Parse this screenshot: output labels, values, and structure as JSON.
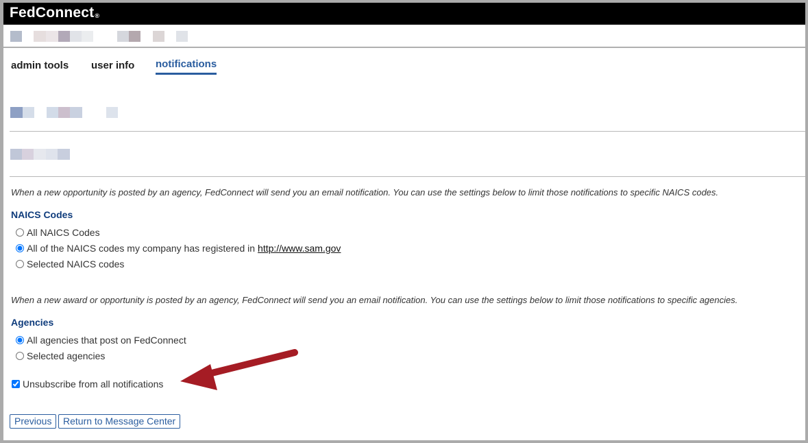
{
  "header": {
    "logo": "FedConnect",
    "registered_mark": "®"
  },
  "tabs": [
    {
      "label": "admin tools",
      "active": false
    },
    {
      "label": "user info",
      "active": false
    },
    {
      "label": "notifications",
      "active": true
    }
  ],
  "naics": {
    "intro": "When a new opportunity is posted by an agency, FedConnect will send you an email notification. You can use the settings below to limit those notifications to specific NAICS codes.",
    "title": "NAICS Codes",
    "options": [
      {
        "label": "All NAICS Codes",
        "selected": false
      },
      {
        "label": "All of the NAICS codes my company has registered in",
        "link": "http://www.sam.gov",
        "selected": true
      },
      {
        "label": "Selected NAICS codes",
        "selected": false
      }
    ]
  },
  "agencies": {
    "intro": "When a new award or opportunity is posted by an agency, FedConnect will send you an email notification. You can use the settings below to limit those notifications to specific agencies.",
    "title": "Agencies",
    "options": [
      {
        "label": "All agencies that post on FedConnect",
        "selected": true
      },
      {
        "label": "Selected agencies",
        "selected": false
      }
    ]
  },
  "unsubscribe": {
    "label": "Unsubscribe from all notifications",
    "checked": true
  },
  "buttons": {
    "previous": "Previous",
    "return": "Return to Message Center"
  },
  "colors": {
    "accent": "#2a5d9f",
    "section_title": "#0f3c7c",
    "annotation_arrow": "#a51c24"
  }
}
